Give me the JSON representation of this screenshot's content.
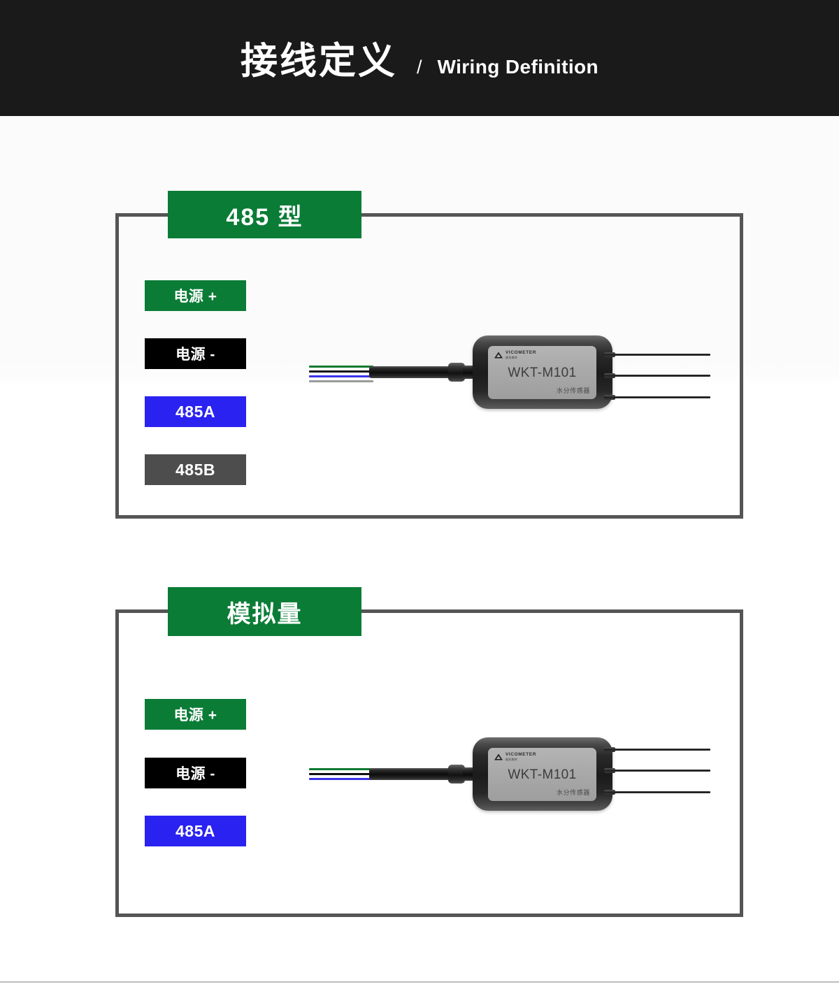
{
  "header": {
    "title_cn": "接线定义",
    "separator": "/",
    "title_en": "Wiring Definition"
  },
  "colors": {
    "brand_green": "#0a7c36",
    "header_bg": "#1a1a1a",
    "panel_border": "#555555",
    "chip_black": "#000000",
    "chip_blue": "#2a22f0",
    "chip_gray": "#4d4d4d",
    "wire_green": "#0f7a2e",
    "wire_black": "#101010",
    "wire_blue": "#3a34e8",
    "wire_gray": "#9a9a9a"
  },
  "sensor": {
    "brand": "VICOMETER",
    "brand_sub": "维科美特",
    "model": "WKT-M101",
    "type_label": "水分传感器",
    "logo_icon": "mountain-triangle-icon"
  },
  "panels": [
    {
      "id": "485",
      "tab_label": "485 型",
      "chips": [
        {
          "label": "电源 +",
          "color": "#0a7c36",
          "wire": "green"
        },
        {
          "label": "电源 -",
          "color": "#000000",
          "wire": "black"
        },
        {
          "label": "485A",
          "color": "#2a22f0",
          "wire": "blue"
        },
        {
          "label": "485B",
          "color": "#4d4d4d",
          "wire": "gray"
        }
      ]
    },
    {
      "id": "analog",
      "tab_label": "模拟量",
      "chips": [
        {
          "label": "电源 +",
          "color": "#0a7c36",
          "wire": "green"
        },
        {
          "label": "电源 -",
          "color": "#000000",
          "wire": "black"
        },
        {
          "label": "485A",
          "color": "#2a22f0",
          "wire": "blue"
        }
      ]
    }
  ]
}
